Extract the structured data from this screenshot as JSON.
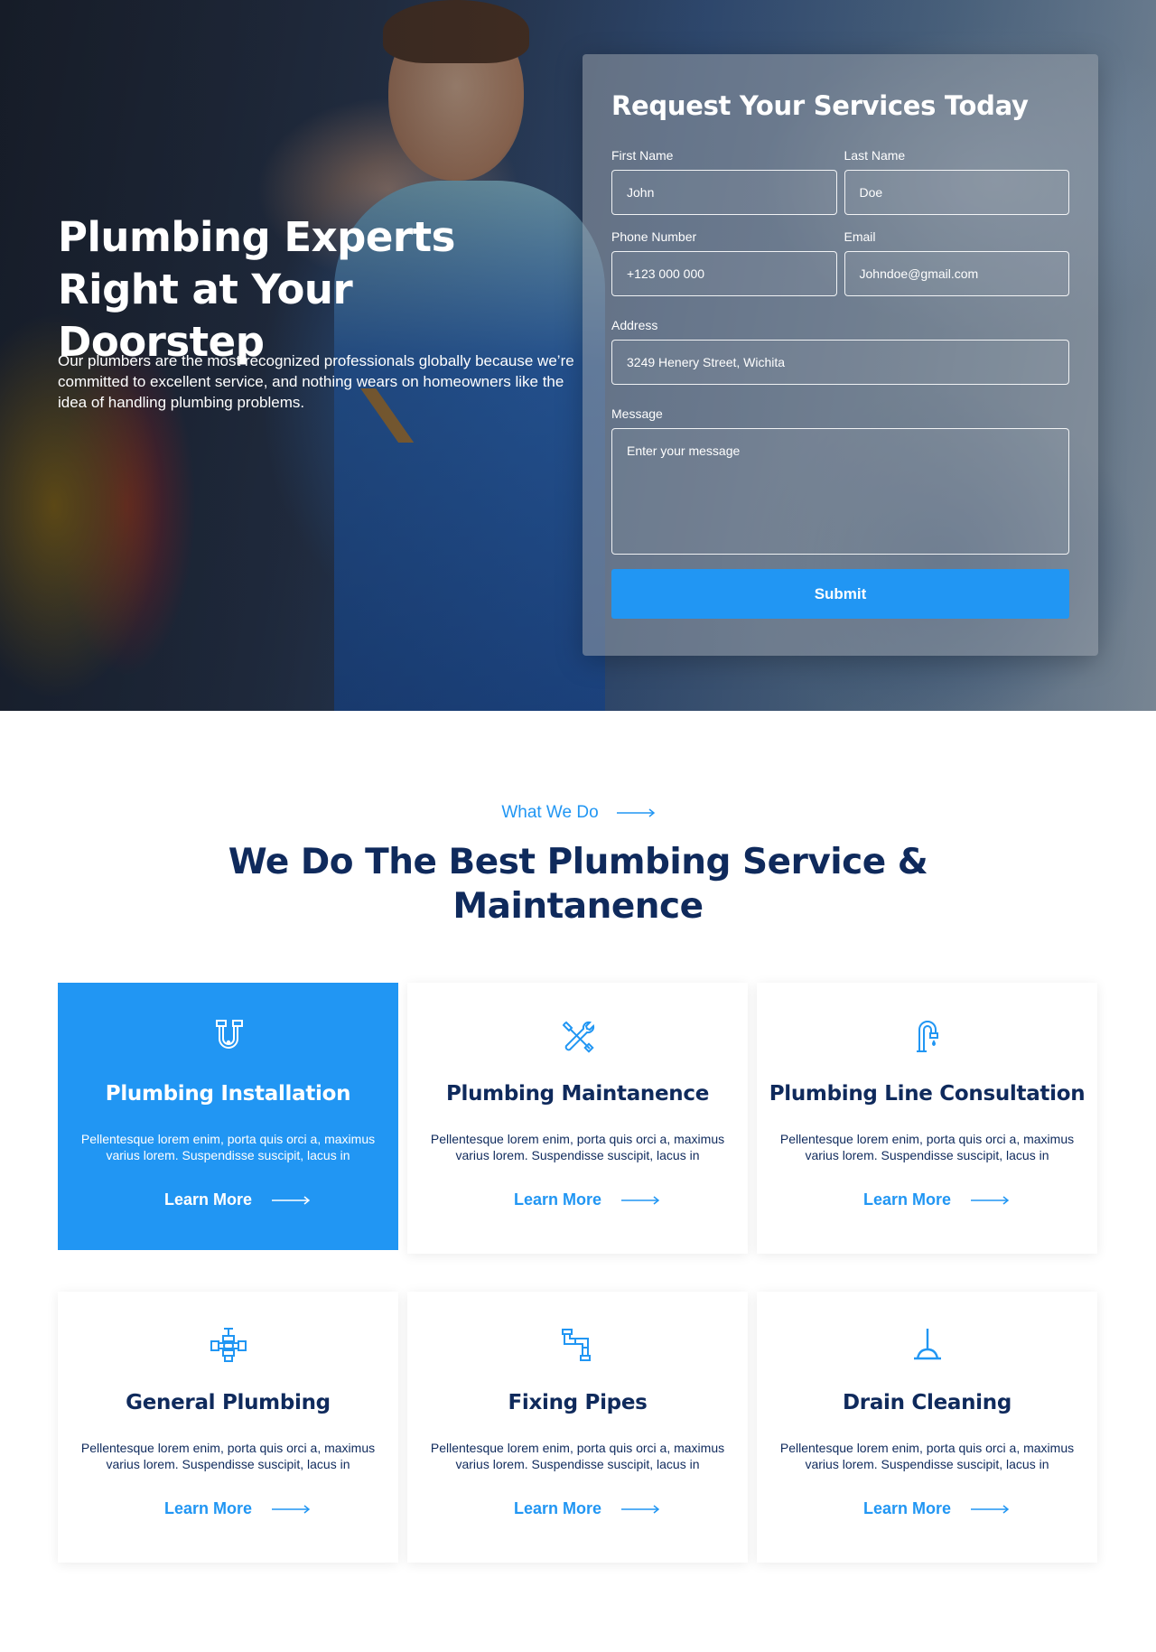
{
  "hero": {
    "title": "Plumbing Experts Right at Your Doorstep",
    "description": "Our plumbers are the most recognized professionals globally because we’re committed to excellent service, and nothing wears on homeowners like the idea of handling plumbing problems."
  },
  "form": {
    "title": "Request Your Services Today",
    "first_name_label": "First Name",
    "first_name_value": "John",
    "last_name_label": "Last Name",
    "last_name_value": "Doe",
    "phone_label": "Phone Number",
    "phone_value": "+123 000 000",
    "email_label": "Email",
    "email_value": "Johndoe@gmail.com",
    "address_label": "Address",
    "address_value": "3249 Henery Street, Wichita",
    "message_label": "Message",
    "message_placeholder": "Enter your message",
    "submit_label": "Submit"
  },
  "services": {
    "eyebrow": "What We Do",
    "title": "We Do The Best Plumbing Service & Maintanence",
    "accent_color": "#2196f3",
    "heading_color": "#0f2a5c",
    "cards": [
      {
        "icon": "pipe-trap-icon",
        "title": "Plumbing Installation",
        "text": "Pellentesque lorem enim, porta quis orci a, maximus varius lorem. Suspendisse suscipit, lacus in",
        "link": "Learn More",
        "active": true
      },
      {
        "icon": "tools-icon",
        "title": "Plumbing Maintanence",
        "text": "Pellentesque lorem enim, porta quis orci a, maximus varius lorem. Suspendisse suscipit, lacus in",
        "link": "Learn More",
        "active": false
      },
      {
        "icon": "faucet-icon",
        "title": "Plumbing Line Consultation",
        "text": "Pellentesque lorem enim, porta quis orci a, maximus varius lorem. Suspendisse suscipit, lacus in",
        "link": "Learn More",
        "active": false
      },
      {
        "icon": "valve-icon",
        "title": "General Plumbing",
        "text": "Pellentesque lorem enim, porta quis orci a, maximus varius lorem. Suspendisse suscipit, lacus in",
        "link": "Learn More",
        "active": false
      },
      {
        "icon": "bent-pipe-icon",
        "title": "Fixing Pipes",
        "text": "Pellentesque lorem enim, porta quis orci a, maximus varius lorem. Suspendisse suscipit, lacus in",
        "link": "Learn More",
        "active": false
      },
      {
        "icon": "plunger-icon",
        "title": "Drain Cleaning",
        "text": "Pellentesque lorem enim, porta quis orci a, maximus varius lorem. Suspendisse suscipit, lacus in",
        "link": "Learn More",
        "active": false
      }
    ]
  }
}
